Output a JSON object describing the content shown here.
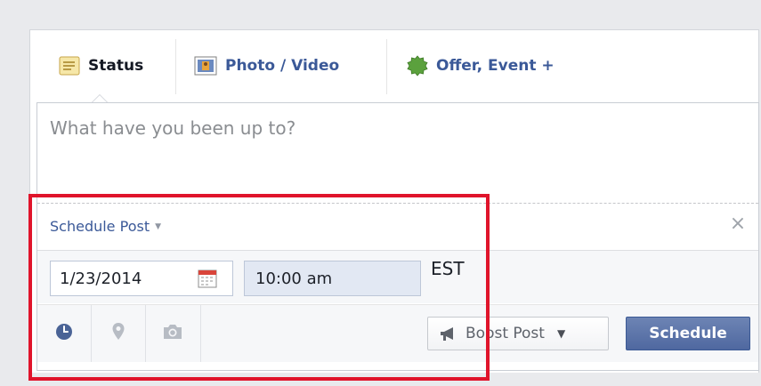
{
  "tabs": {
    "status": "Status",
    "photo": "Photo / Video",
    "offer": "Offer, Event +"
  },
  "composer": {
    "placeholder": "What have you been up to?"
  },
  "schedule": {
    "title": "Schedule Post",
    "close": "×",
    "date": "1/23/2014",
    "time": "10:00 am",
    "timezone": "EST"
  },
  "toolbar": {
    "boost_label": "Boost Post",
    "schedule_label": "Schedule"
  },
  "icons": {
    "status": "status-note-icon",
    "photo": "photo-icon",
    "offer": "offer-badge-icon",
    "calendar": "calendar-icon",
    "clock": "clock-icon",
    "location": "location-pin-icon",
    "camera": "camera-icon",
    "megaphone": "megaphone-icon"
  },
  "colors": {
    "link": "#3b5998",
    "highlight": "#e0142b",
    "primary_button": "#5b74a8"
  }
}
